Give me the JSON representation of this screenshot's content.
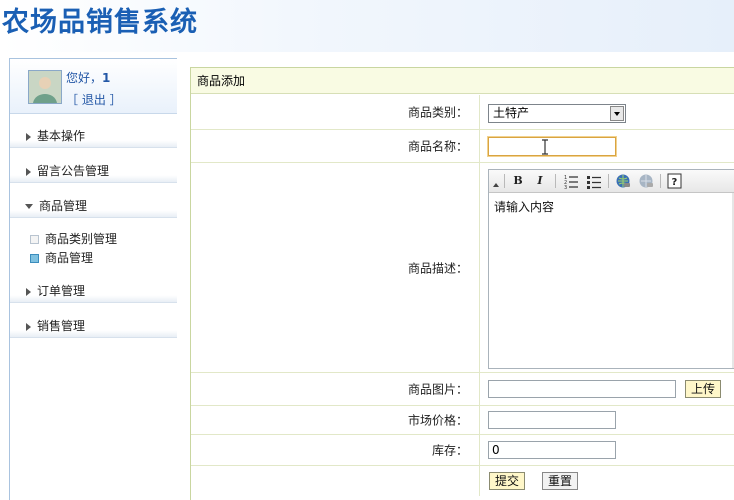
{
  "header": {
    "title": "农场品销售系统"
  },
  "sidebar": {
    "greeting_prefix": "您好，",
    "username": "1",
    "logout_label": "［ 退出 ］",
    "menu": [
      {
        "label": "基本操作"
      },
      {
        "label": "留言公告管理"
      },
      {
        "label": "商品管理"
      },
      {
        "label": "订单管理"
      },
      {
        "label": "销售管理"
      }
    ],
    "submenu": [
      {
        "label": "商品类别管理"
      },
      {
        "label": "商品管理"
      }
    ]
  },
  "form": {
    "title": "商品添加",
    "category_label": "商品类别：",
    "category_value": "土特产",
    "name_label": "商品名称：",
    "name_value": "",
    "description_label": "商品描述：",
    "description_placeholder": "请输入内容",
    "image_label": "商品图片：",
    "image_value": "",
    "upload_label": "上传",
    "price_label": "市场价格：",
    "price_value": "",
    "stock_label": "库存：",
    "stock_value": "0",
    "submit_label": "提交",
    "reset_label": "重置"
  },
  "editor_toolbar": {
    "bold": "B",
    "italic": "I",
    "help": "?"
  },
  "colors": {
    "title_blue": "#1a5fb4",
    "link_blue": "#2357a6",
    "button_yellow": "#fff7c9",
    "focus_orange": "#d9a441"
  }
}
